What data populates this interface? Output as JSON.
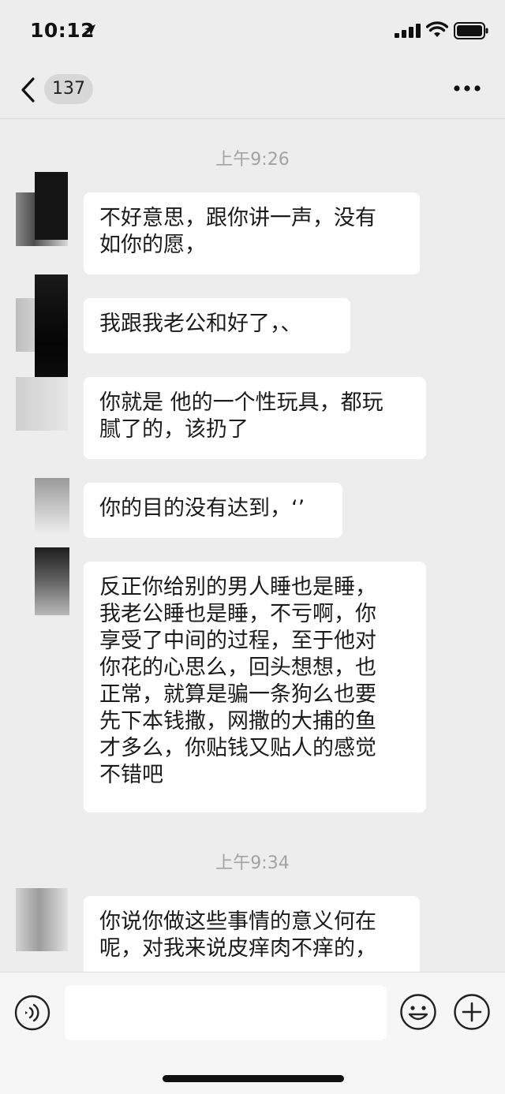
{
  "status_bar": {
    "time": "10:12",
    "icons": [
      "location-arrow-icon",
      "cellular-signal-icon",
      "wifi-icon",
      "battery-icon"
    ]
  },
  "nav": {
    "back_icon": "chevron-left-icon",
    "unread_count": "137",
    "more_icon": "more-horizontal-icon"
  },
  "messages": {
    "timestamps": [
      "上午9:26",
      "上午9:34"
    ],
    "bubbles": [
      {
        "lines": [
          "不好意思，跟你讲一声，没有",
          "如你的愿，"
        ]
      },
      {
        "lines": [
          "我跟我老公和好了，、"
        ]
      },
      {
        "lines": [
          "你就是 他的一个性玩具，都玩",
          "腻了的，该扔了"
        ]
      },
      {
        "lines": [
          "你的目的没有达到，‘’"
        ]
      },
      {
        "lines": [
          "反正你给别的男人睡也是睡，",
          "我老公睡也是睡，不亏啊，你",
          "享受了中间的过程，至于他对",
          "你花的心思么，回头想想，也",
          "正常，就算是骗一条狗么也要",
          "先下本钱撒，网撒的大捕的鱼",
          "才多么，你贴钱又贴人的感觉",
          "不错吧"
        ]
      },
      {
        "lines": [
          "你说你做这些事情的意义何在",
          "呢，对我来说皮痒肉不痒的，"
        ]
      }
    ]
  },
  "input_bar": {
    "voice_icon": "voice-input-icon",
    "text_value": "",
    "emoji_icon": "emoji-smile-icon",
    "plus_icon": "plus-circle-icon"
  },
  "colors": {
    "background": "#ededed",
    "bubble": "#ffffff",
    "timestamp": "#a3a3a3",
    "badge": "#d7d7d7"
  }
}
